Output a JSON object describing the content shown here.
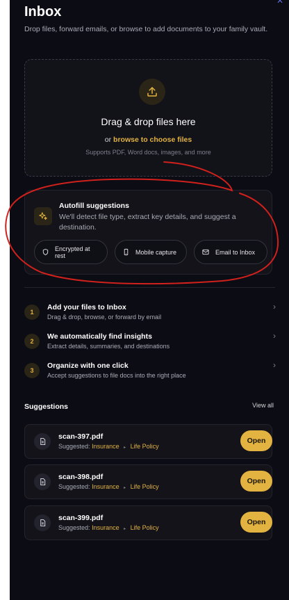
{
  "header": {
    "title": "Inbox",
    "subtitle": "Drop files, forward emails, or browse to add documents to your family vault."
  },
  "dropzone": {
    "title": "Drag & drop files here",
    "browse_prefix": "or",
    "browse_link": "browse to choose files",
    "supports": "Supports PDF, Word docs, images, and more"
  },
  "autofill": {
    "title": "Autofill suggestions",
    "description": "We'll detect file type, extract key details, and suggest a destination.",
    "chips": [
      {
        "label": "Encrypted at rest",
        "icon": "shield-icon"
      },
      {
        "label": "Mobile capture",
        "icon": "phone-icon"
      },
      {
        "label": "Email to Inbox",
        "icon": "mail-icon"
      }
    ]
  },
  "steps": [
    {
      "num": "1",
      "title": "Add your files to Inbox",
      "desc": "Drag & drop, browse, or forward by email"
    },
    {
      "num": "2",
      "title": "We automatically find insights",
      "desc": "Extract details, summaries, and destinations"
    },
    {
      "num": "3",
      "title": "Organize with one click",
      "desc": "Accept suggestions to file docs into the right place"
    }
  ],
  "suggestions": {
    "title": "Suggestions",
    "view_all": "View all",
    "items": [
      {
        "file": "scan-397.pdf",
        "prefix": "Suggested:",
        "category": "Insurance",
        "sub": "Life Policy",
        "action": "Open"
      },
      {
        "file": "scan-398.pdf",
        "prefix": "Suggested:",
        "category": "Insurance",
        "sub": "Life Policy",
        "action": "Open"
      },
      {
        "file": "scan-399.pdf",
        "prefix": "Suggested:",
        "category": "Insurance",
        "sub": "Life Policy",
        "action": "Open"
      }
    ]
  },
  "colors": {
    "accent": "#e3b341",
    "background": "#0c0c14",
    "annotation": "#d0211c"
  }
}
